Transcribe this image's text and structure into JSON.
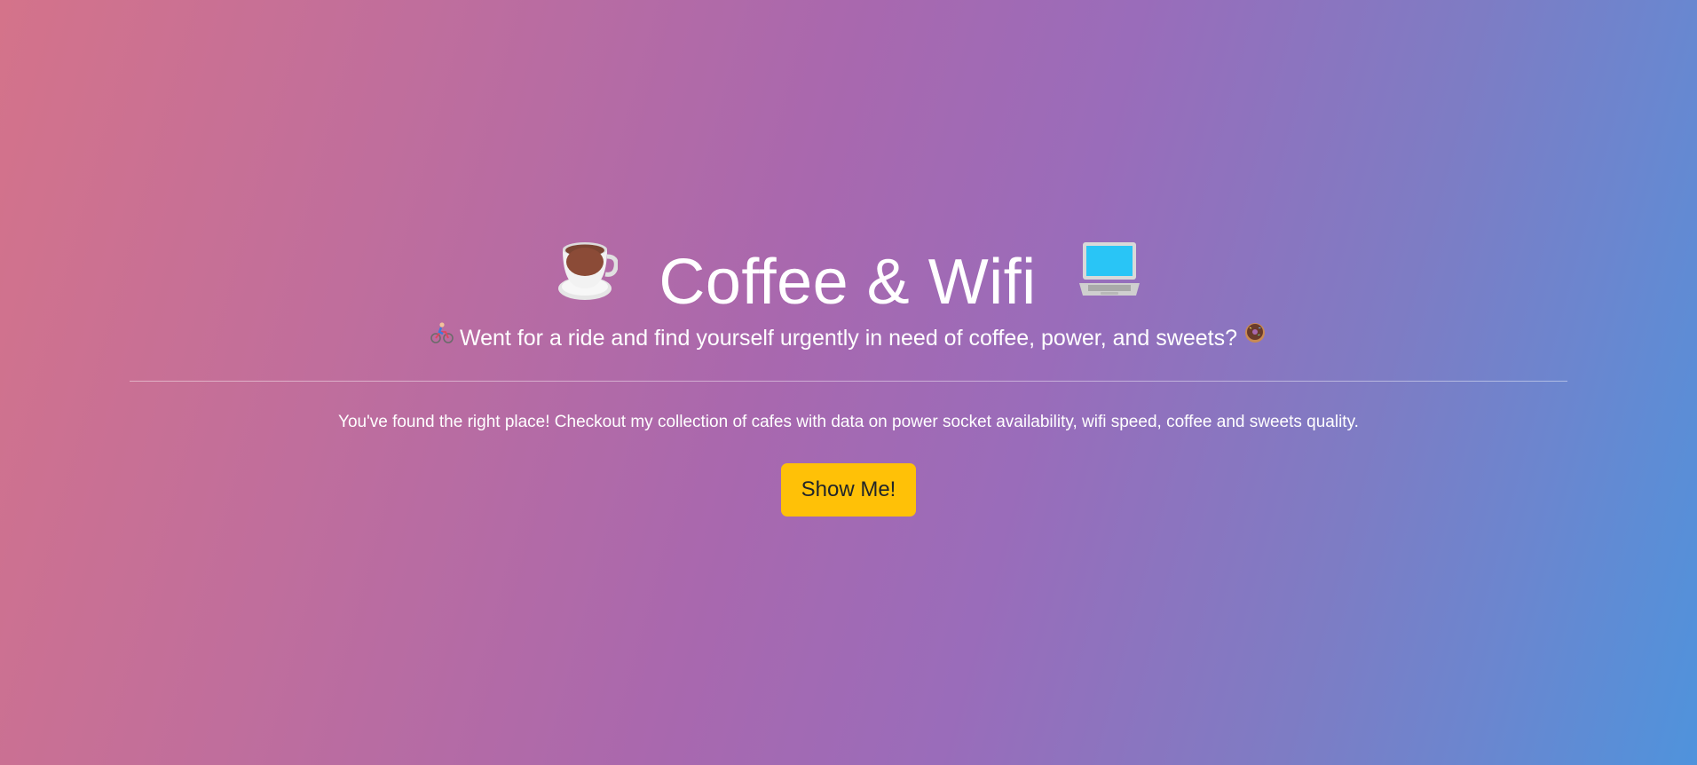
{
  "hero": {
    "title": "Coffee & Wifi",
    "title_left_icon": "coffee-cup-icon",
    "title_right_icon": "laptop-icon",
    "subtitle": "Went for a ride and find yourself urgently in need of coffee, power, and sweets?",
    "subtitle_left_icon": "cyclist-icon",
    "subtitle_right_icon": "donut-icon",
    "lead": "You've found the right place! Checkout my collection of cafes with data on power socket availability, wifi speed, coffee and sweets quality.",
    "button_label": "Show Me!"
  },
  "colors": {
    "background_start": "#d4738a",
    "background_mid": "#a968ae",
    "background_end": "#4f93dc",
    "button": "#ffc107",
    "button_text": "#212529",
    "text": "#ffffff"
  }
}
